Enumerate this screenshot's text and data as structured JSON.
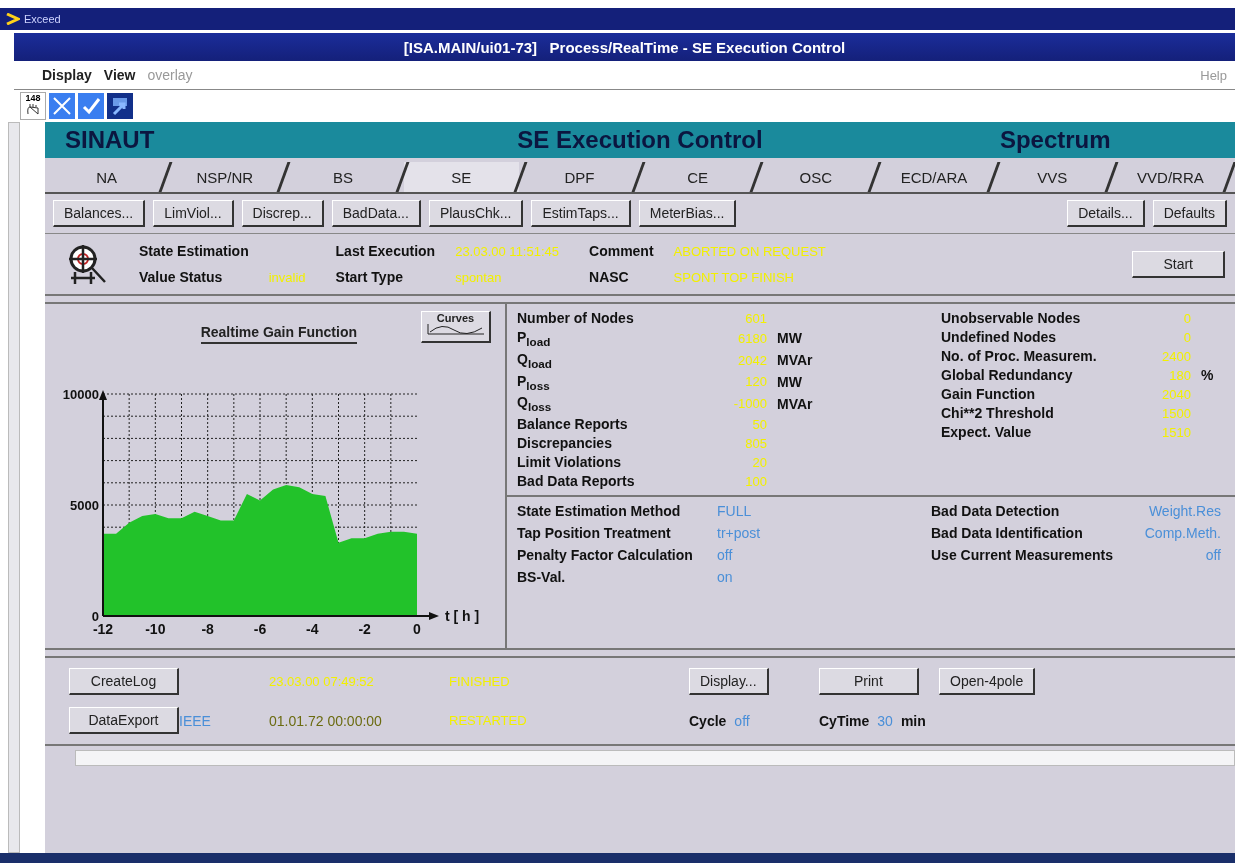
{
  "window": {
    "app_title": "Exceed",
    "title": "[ISA.MAIN/ui01-73]   Process/RealTime - SE Execution Control"
  },
  "menu": [
    {
      "label": "Display",
      "disabled": false
    },
    {
      "label": "View",
      "disabled": false
    },
    {
      "label": "overlay",
      "disabled": true
    }
  ],
  "help": "Help",
  "toolbar": {
    "badge": "148"
  },
  "header": {
    "left": "SINAUT",
    "center": "SE Execution Control",
    "right": "Spectrum"
  },
  "tabs": [
    {
      "label": "NA",
      "selected": false
    },
    {
      "label": "NSP/NR",
      "selected": false
    },
    {
      "label": "BS",
      "selected": false
    },
    {
      "label": "SE",
      "selected": true
    },
    {
      "label": "DPF",
      "selected": false
    },
    {
      "label": "CE",
      "selected": false
    },
    {
      "label": "OSC",
      "selected": false
    },
    {
      "label": "ECD/ARA",
      "selected": false
    },
    {
      "label": "VVS",
      "selected": false
    },
    {
      "label": "VVD/RRA",
      "selected": false
    }
  ],
  "buttons": [
    "Balances...",
    "LimViol...",
    "Discrep...",
    "BadData...",
    "PlausChk...",
    "EstimTaps...",
    "MeterBias..."
  ],
  "right_buttons": [
    "Details...",
    "Defaults"
  ],
  "status": {
    "title": "State Estimation",
    "value_status_label": "Value Status",
    "value_status": "invalid",
    "last_execution_label": "Last Execution",
    "last_execution": "23.03.00 11:51:45",
    "start_type_label": "Start Type",
    "start_type": "spontan",
    "comment_label": "Comment",
    "comment": "ABORTED ON REQUEST",
    "nasc_label": "NASC",
    "nasc": "SPONT TOP FINISH",
    "start_button": "Start"
  },
  "chart": {
    "title": "Realtime Gain Function",
    "curves_button": "Curves",
    "x_unit": "t [ h ]",
    "chart_data": {
      "type": "area",
      "x": [
        -12,
        -11.5,
        -11,
        -10.5,
        -10,
        -9.5,
        -9,
        -8.5,
        -8,
        -7.5,
        -7,
        -6.5,
        -6,
        -5.5,
        -5,
        -4.5,
        -4,
        -3.5,
        -3,
        -2.5,
        -2,
        -1.5,
        -1,
        -0.5,
        0
      ],
      "series": [
        {
          "color": "#22c22a",
          "values": [
            3700,
            3700,
            4200,
            4500,
            4600,
            4400,
            4400,
            4700,
            4500,
            4300,
            4300,
            5500,
            5200,
            5700,
            5900,
            5800,
            5500,
            5400,
            3300,
            3500,
            3500,
            3700,
            3800,
            3800,
            3700
          ]
        }
      ],
      "xlim": [
        -12,
        0
      ],
      "ylim": [
        0,
        10000
      ],
      "xticks": [
        -12,
        -10,
        -8,
        -6,
        -4,
        -2,
        0
      ],
      "yticks": [
        0,
        5000,
        10000
      ],
      "grid": true
    }
  },
  "left_stats": [
    {
      "label": "Number of Nodes",
      "value": "601"
    },
    {
      "label": "P$_{load}$",
      "value": "6180",
      "unit": "MW"
    },
    {
      "label": "Q$_{load}$",
      "value": "2042",
      "unit": "MVAr"
    },
    {
      "label": "P$_{loss}$",
      "value": "120",
      "unit": "MW"
    },
    {
      "label": "Q$_{loss}$",
      "value": "-1000",
      "unit": "MVAr"
    },
    {
      "label": "Balance Reports",
      "value": "50"
    },
    {
      "label": "Discrepancies",
      "value": "805"
    },
    {
      "label": "Limit Violations",
      "value": "20"
    },
    {
      "label": "Bad Data Reports",
      "value": "100"
    }
  ],
  "right_stats": [
    {
      "label": "Unobservable Nodes",
      "value": "0"
    },
    {
      "label": "Undefined Nodes",
      "value": "0"
    },
    {
      "label": "No. of Proc. Measurem.",
      "value": "2400"
    },
    {
      "label": "Global Redundancy",
      "value": "180",
      "unit": "%"
    },
    {
      "label": "Gain Function",
      "value": "2040"
    },
    {
      "label": "Chi**2 Threshold",
      "value": "1500"
    },
    {
      "label": "Expect. Value",
      "value": "1510"
    }
  ],
  "method_left": [
    {
      "label": "State Estimation Method",
      "value": "FULL"
    },
    {
      "label": "Tap Position Treatment",
      "value": "tr+post"
    },
    {
      "label": "Penalty Factor Calculation",
      "value": "off"
    },
    {
      "label": "BS-Val.",
      "value": "on"
    }
  ],
  "method_right": [
    {
      "label": "Bad Data Detection",
      "value": "Weight.Res"
    },
    {
      "label": "Bad Data Identification",
      "value": "Comp.Meth."
    },
    {
      "label": "Use Current Measurements",
      "value": "off"
    }
  ],
  "log": {
    "create_button": "CreateLog",
    "create_time": "23.03.00 07:49:52",
    "create_status": "FINISHED",
    "export_button": "DataExport",
    "export_format": "IEEE",
    "export_time": "01.01.72 00:00:00",
    "export_status": "RESTARTED",
    "display_button": "Display...",
    "print_button": "Print",
    "open_button": "Open-4pole",
    "cycle_label": "Cycle",
    "cycle": "off",
    "cytime_label": "CyTime",
    "cytime": "30",
    "cytime_unit": "min"
  }
}
